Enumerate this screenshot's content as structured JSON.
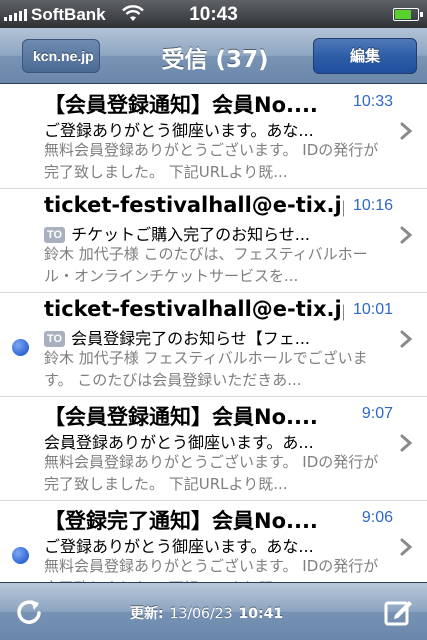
{
  "status_bar": {
    "carrier": "SoftBank",
    "time": "10:43",
    "battery_level": 0.75
  },
  "nav": {
    "back_label": "kcn.ne.jp",
    "title": "受信 (37)",
    "edit_label": "編集"
  },
  "messages": [
    {
      "unread": false,
      "sender": "【会員登録通知】会員No....",
      "time": "10:33",
      "to_badge": "",
      "subject": "ご登録ありがとう御座います。あな...",
      "preview": "無料会員登録ありがとうございます。 IDの発行が完了致しました。 下記URLより既..."
    },
    {
      "unread": false,
      "sender": "ticket-festivalhall@e-tix.jp",
      "time": "10:16",
      "to_badge": "TO",
      "subject": "チケットご購入完了のお知らせ...",
      "preview": "鈴木 加代子様 このたびは、フェスティバルホール・オンラインチケットサービスを..."
    },
    {
      "unread": true,
      "sender": "ticket-festivalhall@e-tix.jp",
      "time": "10:01",
      "to_badge": "TO",
      "subject": "会員登録完了のお知らせ【フェ...",
      "preview": "鈴木 加代子様 フェスティバルホールでございます。 このたびは会員登録いただきあ..."
    },
    {
      "unread": false,
      "sender": "【会員登録通知】会員No....",
      "time": "9:07",
      "to_badge": "",
      "subject": "会員登録ありがとう御座います。あ...",
      "preview": "無料会員登録ありがとうございます。 IDの発行が完了致しました。 下記URLより既..."
    },
    {
      "unread": true,
      "sender": "【登録完了通知】会員No....",
      "time": "9:06",
      "to_badge": "",
      "subject": "ご登録ありがとう御座います。あな...",
      "preview": "無料会員登録ありがとうございます。 IDの発行が完了致しました。 下記URLより既..."
    }
  ],
  "toolbar": {
    "updated_label": "更新:",
    "updated_date": "13/06/23",
    "updated_time": "10:41"
  },
  "icons": {
    "refresh": "refresh-icon",
    "compose": "compose-icon",
    "chevron": "chevron-right-icon"
  },
  "colors": {
    "time_blue": "#2e67c8",
    "unread_dot": "#2f66d4",
    "navbar": "#7994b4"
  }
}
